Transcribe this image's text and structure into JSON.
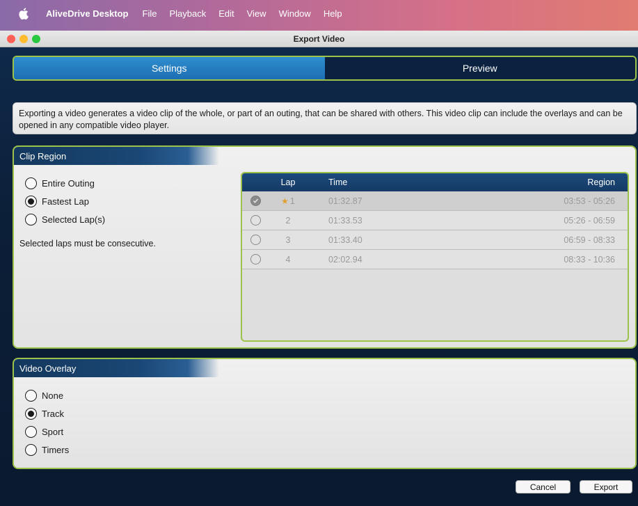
{
  "menubar": {
    "app_name": "AliveDrive Desktop",
    "items": [
      "File",
      "Playback",
      "Edit",
      "View",
      "Window",
      "Help"
    ]
  },
  "window": {
    "title": "Export Video"
  },
  "tabs": [
    {
      "label": "Settings",
      "active": true
    },
    {
      "label": "Preview",
      "active": false
    }
  ],
  "description": "Exporting a video generates a video clip of the whole, or part of an outing, that can be shared with others. This video clip can include the overlays and can be opened in any compatible video player.",
  "clip_region": {
    "title": "Clip Region",
    "options": [
      {
        "label": "Entire Outing",
        "checked": false
      },
      {
        "label": "Fastest Lap",
        "checked": true
      },
      {
        "label": "Selected Lap(s)",
        "checked": false
      }
    ],
    "note": "Selected laps must be consecutive.",
    "table": {
      "headers": {
        "lap": "Lap",
        "time": "Time",
        "region": "Region"
      },
      "rows": [
        {
          "lap": "1",
          "time": "01:32.87",
          "region": "03:53 - 05:26",
          "selected": true,
          "fastest": true
        },
        {
          "lap": "2",
          "time": "01:33.53",
          "region": "05:26 - 06:59",
          "selected": false,
          "fastest": false
        },
        {
          "lap": "3",
          "time": "01:33.40",
          "region": "06:59 - 08:33",
          "selected": false,
          "fastest": false
        },
        {
          "lap": "4",
          "time": "02:02.94",
          "region": "08:33 - 10:36",
          "selected": false,
          "fastest": false
        }
      ]
    }
  },
  "video_overlay": {
    "title": "Video Overlay",
    "options": [
      {
        "label": "None",
        "checked": false
      },
      {
        "label": "Track",
        "checked": true
      },
      {
        "label": "Sport",
        "checked": false
      },
      {
        "label": "Timers",
        "checked": false
      }
    ]
  },
  "buttons": {
    "cancel": "Cancel",
    "export": "Export"
  },
  "colors": {
    "accent_green": "#9cc24a",
    "active_tab": "#2f8dcf",
    "header_blue": "#1c4a7c",
    "star": "#e0a030"
  }
}
